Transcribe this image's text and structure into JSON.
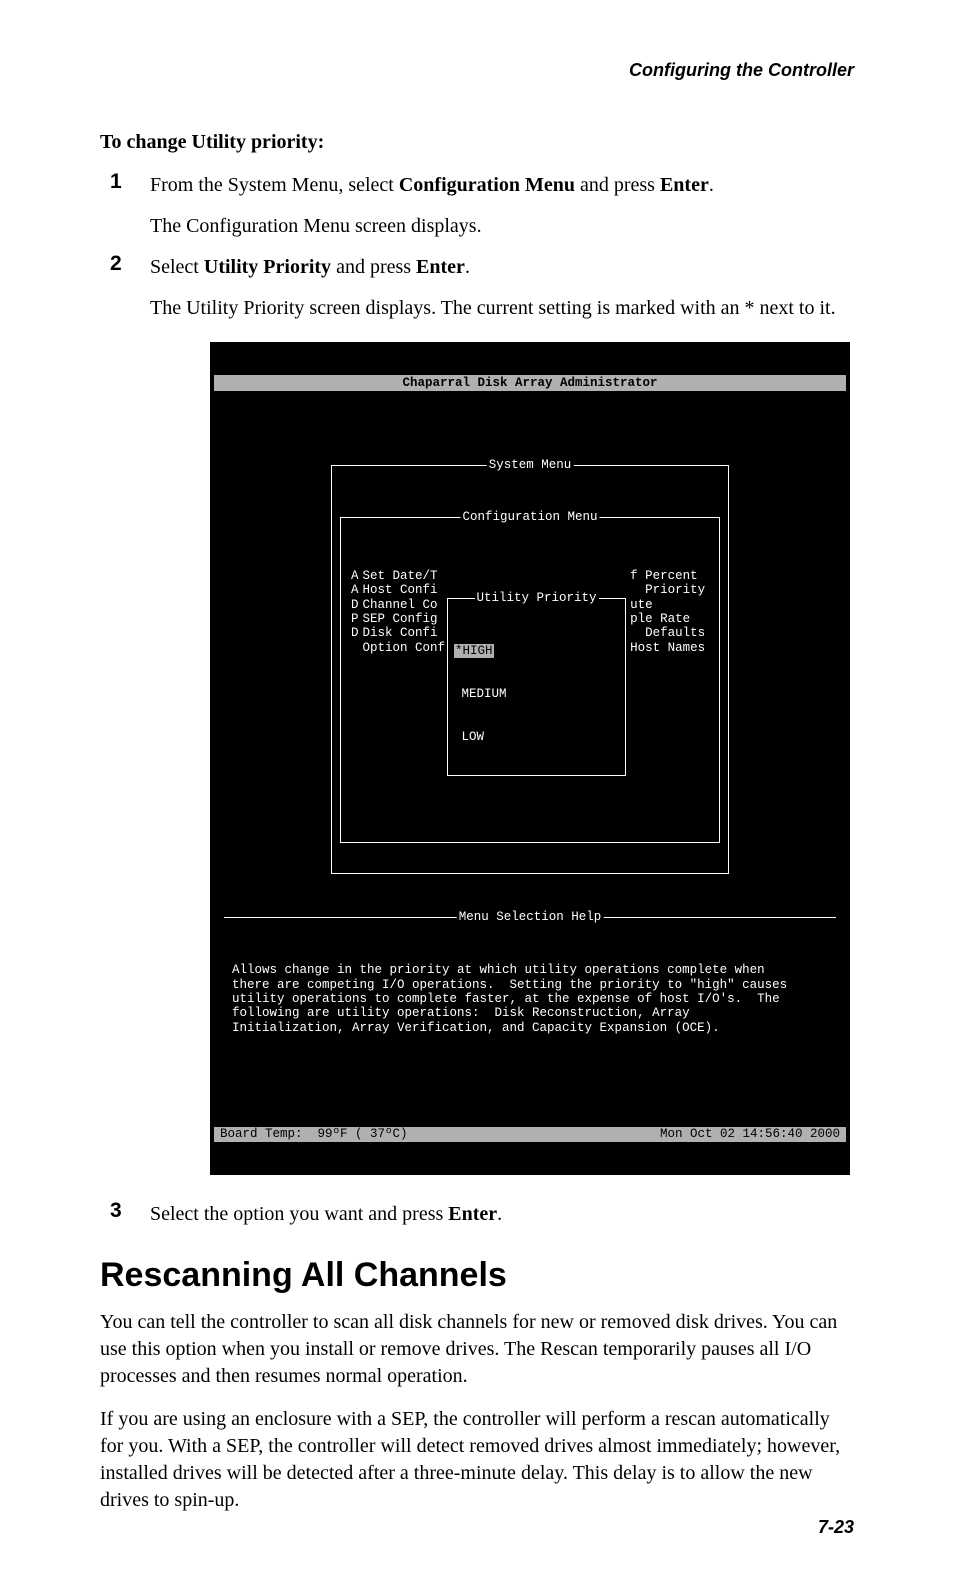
{
  "header": "Configuring the Controller",
  "subhead": "To change Utility priority:",
  "steps": {
    "s1": {
      "num": "1",
      "pre1": "From the System Menu, select ",
      "b1": "Configuration Menu",
      "mid1": " and press ",
      "b2": "Enter",
      "post1": ".",
      "para2": "The Configuration Menu screen displays."
    },
    "s2": {
      "num": "2",
      "pre1": "Select ",
      "b1": "Utility Priority",
      "mid1": " and press ",
      "b2": "Enter",
      "post1": ".",
      "para2": "The Utility Priority screen displays. The current setting is marked with an * next to it."
    },
    "s3": {
      "num": "3",
      "pre1": "Select the option you want and press ",
      "b1": "Enter",
      "post1": "."
    }
  },
  "terminal": {
    "title": "Chaparral Disk Array Administrator",
    "system_menu_label": "System Menu",
    "config_menu_label": "Configuration Menu",
    "priority_label": "Utility Priority",
    "left_col": "A\nA\nD\nP\nD",
    "menu_items": "Set Date/T\nHost Confi\nChannel Co\nSEP Config\nDisk Confi\nOption Conf",
    "priority_items": {
      "selected": "*HIGH",
      "opt2": " MEDIUM",
      "opt3": " LOW"
    },
    "right_col": "f Percent\n  Priority\nute\nple Rate\n  Defaults\nHost Names",
    "help_label": "Menu Selection Help",
    "help_text": "Allows change in the priority at which utility operations complete when\nthere are competing I/O operations.  Setting the priority to \"high\" causes\nutility operations to complete faster, at the expense of host I/O's.  The\nfollowing are utility operations:  Disk Reconstruction, Array\nInitialization, Array Verification, and Capacity Expansion (OCE).",
    "status_left": "Board Temp:  99ºF ( 37ºC)",
    "status_right": "Mon Oct 02 14:56:40 2000"
  },
  "section_title": "Rescanning All Channels",
  "body1": "You can tell the controller to scan all disk channels for new or removed disk drives. You can use this option when you install or remove drives. The Rescan temporarily pauses all I/O processes and then resumes normal operation.",
  "body2": "If you are using an enclosure with a SEP, the controller will perform a rescan automatically for you. With a SEP, the controller will detect removed drives almost immediately; however, installed drives will be detected after a three-minute delay. This delay is to allow the new drives to spin-up.",
  "page_num": "7-23"
}
